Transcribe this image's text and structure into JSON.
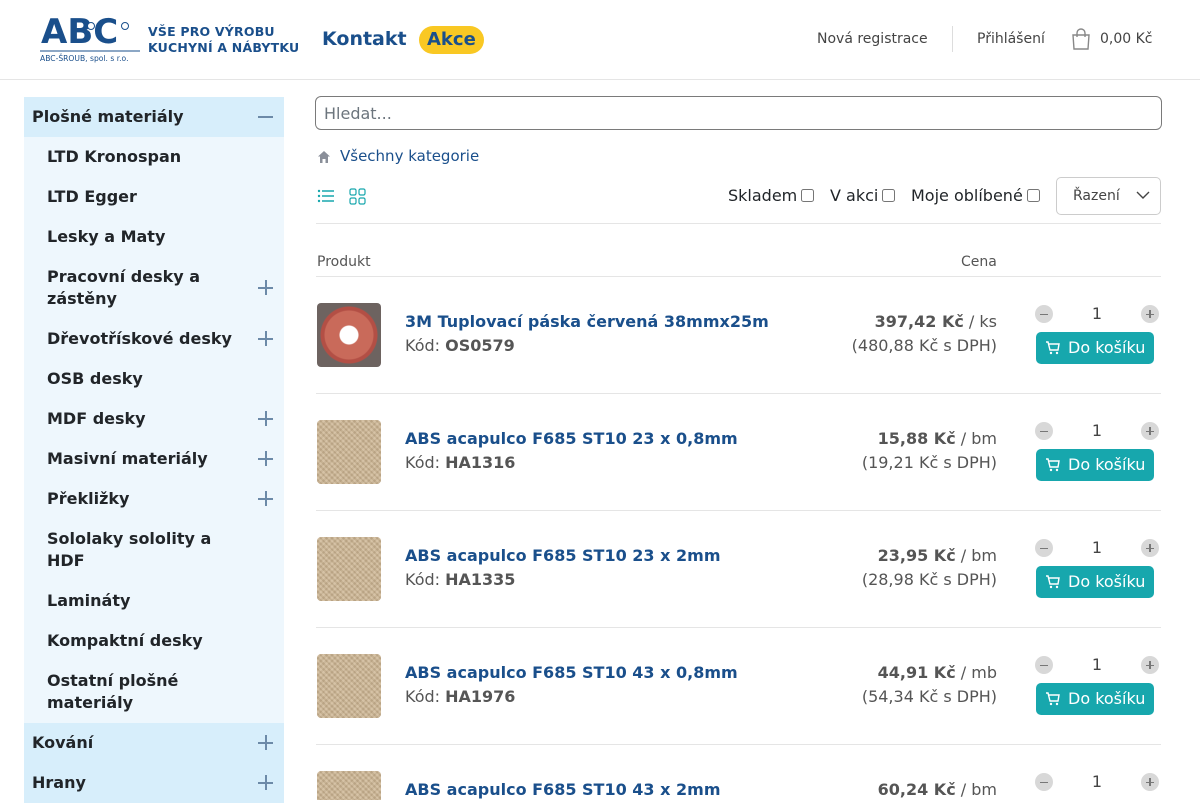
{
  "header": {
    "logo_text": "ABC",
    "logo_company": "ABC-ŠROUB, spol. s r.o.",
    "tagline_line1": "VŠE PRO VÝROBU",
    "tagline_line2": "KUCHYNÍ A NÁBYTKU",
    "nav_kontakt": "Kontakt",
    "nav_akce": "Akce",
    "registration": "Nová registrace",
    "login": "Přihlášení",
    "cart_total": "0,00 Kč"
  },
  "sidebar": {
    "categories": [
      {
        "label": "Plošné materiály",
        "expanded": true
      },
      {
        "label": "Kování",
        "expanded": false
      },
      {
        "label": "Hrany",
        "expanded": false
      }
    ],
    "subcategories": [
      {
        "label": "LTD Kronospan",
        "has_children": false
      },
      {
        "label": "LTD Egger",
        "has_children": false
      },
      {
        "label": "Lesky a Maty",
        "has_children": false
      },
      {
        "label": "Pracovní desky a zástěny",
        "has_children": true
      },
      {
        "label": "Dřevotřískové desky",
        "has_children": true
      },
      {
        "label": "OSB desky",
        "has_children": false
      },
      {
        "label": "MDF desky",
        "has_children": true
      },
      {
        "label": "Masivní materiály",
        "has_children": true
      },
      {
        "label": "Překližky",
        "has_children": true
      },
      {
        "label": "Sololaky sololity a HDF",
        "has_children": false
      },
      {
        "label": "Lamináty",
        "has_children": false
      },
      {
        "label": "Kompaktní desky",
        "has_children": false
      },
      {
        "label": "Ostatní plošné materiály",
        "has_children": false
      }
    ]
  },
  "search": {
    "placeholder": "Hledat..."
  },
  "breadcrumb": {
    "label": "Všechny kategorie"
  },
  "filters": {
    "skladem": "Skladem",
    "v_akci": "V akci",
    "oblibene": "Moje oblíbené",
    "sort_label": "Řazení"
  },
  "table": {
    "col_product": "Produkt",
    "col_price": "Cena",
    "add_label": "Do košíku",
    "code_label": "Kód:",
    "rows": [
      {
        "name": "3M Tuplovací páska červená 38mmx25m",
        "code": "OS0579",
        "price": "397,42 Kč",
        "unit": "/ ks",
        "price_vat": "(480,88 Kč s DPH)",
        "qty": "1",
        "image": "tape"
      },
      {
        "name": "ABS acapulco F685 ST10 23 x 0,8mm",
        "code": "HA1316",
        "price": "15,88 Kč",
        "unit": "/ bm",
        "price_vat": "(19,21 Kč s DPH)",
        "qty": "1",
        "image": "wood"
      },
      {
        "name": "ABS acapulco F685 ST10 23 x 2mm",
        "code": "HA1335",
        "price": "23,95 Kč",
        "unit": "/ bm",
        "price_vat": "(28,98 Kč s DPH)",
        "qty": "1",
        "image": "wood"
      },
      {
        "name": "ABS acapulco F685 ST10 43 x 0,8mm",
        "code": "HA1976",
        "price": "44,91 Kč",
        "unit": "/ mb",
        "price_vat": "(54,34 Kč s DPH)",
        "qty": "1",
        "image": "wood"
      },
      {
        "name": "ABS acapulco F685 ST10 43 x 2mm",
        "code": "",
        "price": "60,24 Kč",
        "unit": "/ bm",
        "price_vat": "",
        "qty": "1",
        "image": "wood"
      }
    ]
  },
  "colors": {
    "brand": "#1a4f8b",
    "accent": "#17a7ad",
    "highlight": "#f9c823",
    "sidebar_top": "#d7eefb",
    "sidebar_sub": "#eef7fd"
  }
}
